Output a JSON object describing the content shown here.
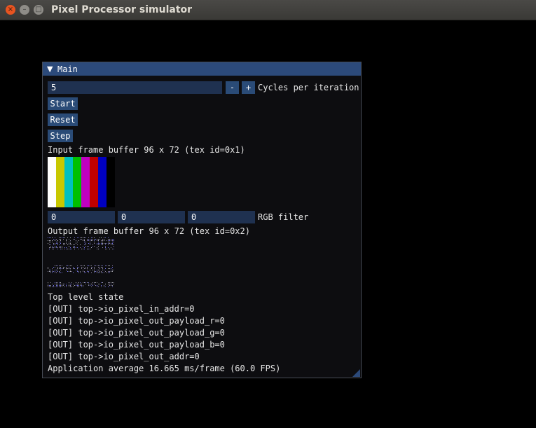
{
  "window": {
    "title": "Pixel Processor simulator"
  },
  "panel": {
    "title": "Main",
    "cycles_value": "5",
    "minus_label": "-",
    "plus_label": "+",
    "cycles_label": "Cycles per iteration",
    "start_label": "Start",
    "reset_label": "Reset",
    "step_label": "Step",
    "input_buffer_label": "Input frame buffer 96 x 72 (tex id=0x1)",
    "rgb": [
      "0",
      "0",
      "0"
    ],
    "rgb_label": "RGB filter",
    "output_buffer_label": "Output frame buffer 96 x 72 (tex id=0x2)",
    "state_title": "Top level state",
    "state_lines": [
      "[OUT] top->io_pixel_in_addr=0",
      "[OUT] top->io_pixel_out_payload_r=0",
      "[OUT] top->io_pixel_out_payload_g=0",
      "[OUT] top->io_pixel_out_payload_b=0",
      "[OUT] top->io_pixel_out_addr=0"
    ],
    "fps_label": "Application average 16.665 ms/frame (60.0 FPS)"
  },
  "colors": {
    "color_bars": [
      "#ffffff",
      "#c8c800",
      "#00c0c0",
      "#00c000",
      "#c000c0",
      "#c00000",
      "#0000c0",
      "#000000"
    ]
  }
}
